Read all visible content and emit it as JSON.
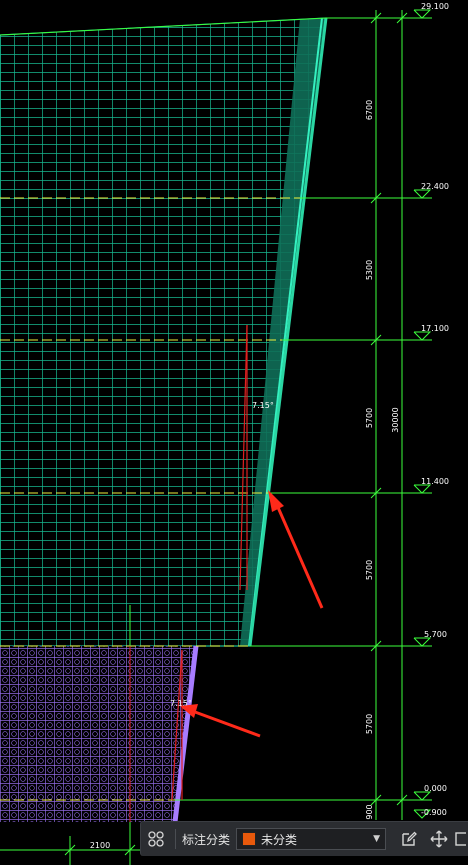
{
  "elevations": {
    "e29100": "29.100",
    "e22400": "22.400",
    "e17100": "17.100",
    "e11400": "11.400",
    "e5700": "5.700",
    "e0000": "0.000",
    "em0900": "-0.900"
  },
  "dimensions": {
    "d6700": "6700",
    "d5300": "5300",
    "d5700a": "5700",
    "d5700b": "5700",
    "d5700c": "5700",
    "d900": "900",
    "total": "30000",
    "bottom": "2100"
  },
  "angles": {
    "upper": "7.15°",
    "lower": "7.15°"
  },
  "toolbar": {
    "annotation_category_label": "标注分类",
    "category_value": "未分类",
    "swatch_color": "#e8590c",
    "icons": [
      "grid-icon",
      "dropdown-arrow-icon",
      "edit-icon",
      "move-icon",
      "copy-icon"
    ]
  },
  "colors": {
    "background": "#000000",
    "grid_green": "#17b890",
    "grid_purple": "#9b72e8",
    "dim_green": "#3cff3c",
    "level_yellow": "#f0f03c",
    "red": "#e02020",
    "arrow_red": "#ff2a1a"
  }
}
